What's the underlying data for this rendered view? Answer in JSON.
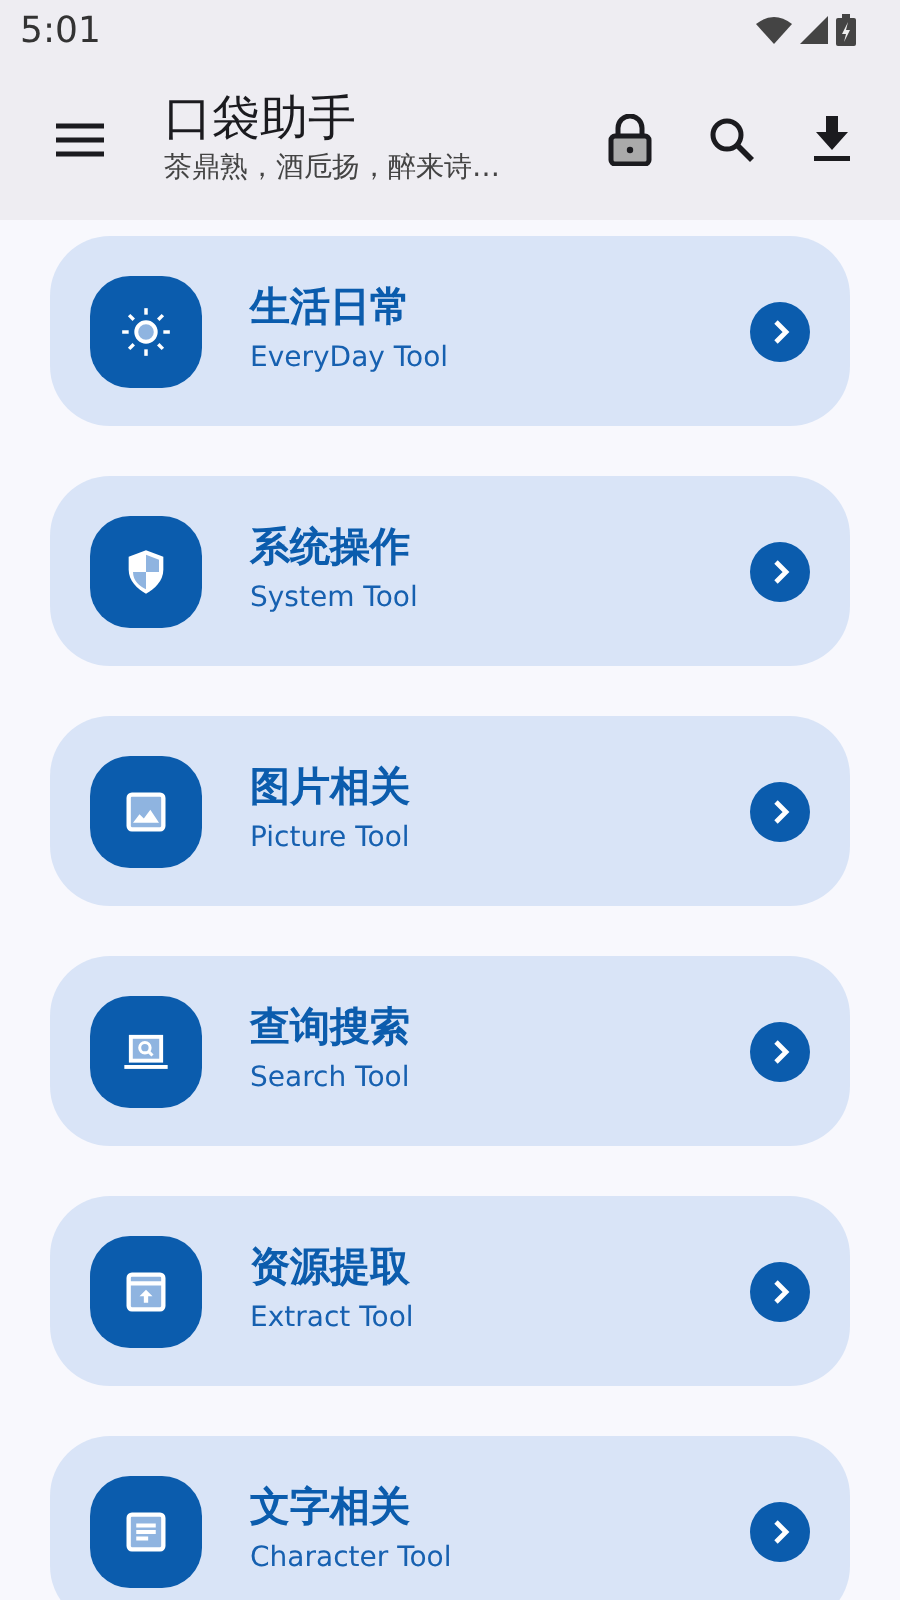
{
  "status_bar": {
    "time": "5:01"
  },
  "app_bar": {
    "title": "口袋助手",
    "subtitle": "茶鼎熟，酒卮扬，醉来诗…"
  },
  "tools": [
    {
      "kind": "sun",
      "title": "生活日常",
      "subtitle": "EveryDay Tool"
    },
    {
      "kind": "shield",
      "title": "系统操作",
      "subtitle": "System Tool"
    },
    {
      "kind": "image",
      "title": "图片相关",
      "subtitle": "Picture Tool"
    },
    {
      "kind": "laptop",
      "title": "查询搜索",
      "subtitle": "Search Tool"
    },
    {
      "kind": "archive",
      "title": "资源提取",
      "subtitle": "Extract Tool"
    },
    {
      "kind": "document",
      "title": "文字相关",
      "subtitle": "Character Tool"
    }
  ]
}
